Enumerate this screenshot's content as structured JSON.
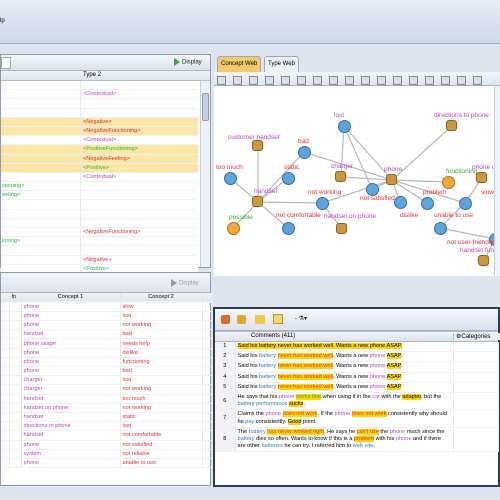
{
  "app": {
    "menu_help": "lp"
  },
  "left_top": {
    "display_label": "Display",
    "col_type2": "Type 2",
    "rows": [
      {
        "a": "",
        "b": "",
        "bg": "#ffffff"
      },
      {
        "a": "",
        "b": "<Contextual>",
        "bg": "#ffffff",
        "bcolor": "#c13fc1"
      },
      {
        "a": "",
        "b": "",
        "bg": "#ffffff"
      },
      {
        "a": "",
        "b": "",
        "bg": "#ffffff"
      },
      {
        "a": "",
        "b": "<Negative>",
        "bg": "#fbe6a6",
        "bcolor": "#e03030"
      },
      {
        "a": "",
        "b": "<NegativeFunctioning>",
        "bg": "#fbe6a6",
        "bcolor": "#e03030"
      },
      {
        "a": "",
        "b": "<Contextual>",
        "bg": "#ffffff",
        "bcolor": "#c13fc1"
      },
      {
        "a": "",
        "b": "<PositiveFunctioning>",
        "bg": "#fbe6a6",
        "bcolor": "#2db52d"
      },
      {
        "a": "",
        "b": "<NegativeFeeling>",
        "bg": "#fbe6a6",
        "bcolor": "#e03030"
      },
      {
        "a": "",
        "b": "<Positive>",
        "bg": "#fbe6a6",
        "bcolor": "#2db52d"
      },
      {
        "a": "",
        "b": "<Contextual>",
        "bg": "#ffffff",
        "bcolor": "#c13fc1"
      },
      {
        "a": "ctioning>",
        "b": "",
        "bg": "#ffffff",
        "acolor": "#2db52d"
      },
      {
        "a": "eeling>",
        "b": "",
        "bg": "#ffffff",
        "acolor": "#2db52d"
      },
      {
        "a": "",
        "b": "",
        "bg": "#ffffff"
      },
      {
        "a": "",
        "b": "",
        "bg": "#ffffff"
      },
      {
        "a": "",
        "b": "",
        "bg": "#ffffff"
      },
      {
        "a": "",
        "b": "<NegativeFunctioning>",
        "bg": "#ffffff",
        "bcolor": "#e03030"
      },
      {
        "a": "ioning>",
        "b": "",
        "bg": "#ffffff",
        "acolor": "#2db52d"
      },
      {
        "a": "",
        "b": "",
        "bg": "#ffffff"
      },
      {
        "a": "",
        "b": "<Negative>",
        "bg": "#ffffff",
        "bcolor": "#e03030"
      },
      {
        "a": "",
        "b": "<Positive>",
        "bg": "#ffffff",
        "bcolor": "#2db52d"
      }
    ]
  },
  "left_bottom": {
    "display_label": "Display",
    "col_in": "In",
    "col_c1": "Concept 1",
    "col_c2": "Concept 2",
    "rows": [
      {
        "c1": "phone",
        "c2": "slow"
      },
      {
        "c1": "phone",
        "c2": "lost"
      },
      {
        "c1": "phone",
        "c2": "not working"
      },
      {
        "c1": "handset",
        "c2": "bad"
      },
      {
        "c1": "phone usage",
        "c2": "needs help"
      },
      {
        "c1": "phone",
        "c2": "dislike"
      },
      {
        "c1": "phone",
        "c2": "functioning"
      },
      {
        "c1": "phone",
        "c2": "bad"
      },
      {
        "c1": "charger",
        "c2": "lost"
      },
      {
        "c1": "charger",
        "c2": "not working"
      },
      {
        "c1": "handset",
        "c2": "too much"
      },
      {
        "c1": "handset on phone",
        "c2": "not working"
      },
      {
        "c1": "handset",
        "c2": "static"
      },
      {
        "c1": "directions to phone",
        "c2": "lost"
      },
      {
        "c1": "handset",
        "c2": "not comfortable"
      },
      {
        "c1": "phone",
        "c2": "not satisfied"
      },
      {
        "c1": "system",
        "c2": "not reliable"
      },
      {
        "c1": "phone",
        "c2": "unable to use"
      }
    ]
  },
  "tabs": {
    "concept_web": "Concept Web",
    "type_web": "Type Web"
  },
  "graph": {
    "nodes": [
      {
        "id": "lost",
        "label": "lost",
        "color": "#c13fc1",
        "kind": "blue"
      },
      {
        "id": "directions",
        "label": "directions to phone",
        "color": "#c13fc1",
        "kind": "tan"
      },
      {
        "id": "customer_handset",
        "label": "customer handset",
        "color": "#c13fc1",
        "kind": "tan"
      },
      {
        "id": "bad",
        "label": "bad",
        "color": "#e03030",
        "kind": "blue"
      },
      {
        "id": "charger",
        "label": "charger",
        "color": "#c13fc1",
        "kind": "tan"
      },
      {
        "id": "phone",
        "label": "phone",
        "color": "#c13fc1",
        "kind": "tan"
      },
      {
        "id": "functioning",
        "label": "functioning",
        "color": "#2db52d",
        "kind": "orange"
      },
      {
        "id": "too_much",
        "label": "too much",
        "color": "#e03030",
        "kind": "blue"
      },
      {
        "id": "static",
        "label": "static",
        "color": "#e03030",
        "kind": "blue"
      },
      {
        "id": "phone_us",
        "label": "phone us",
        "color": "#c13fc1",
        "kind": "tan"
      },
      {
        "id": "handset",
        "label": "handset",
        "color": "#c13fc1",
        "kind": "tan"
      },
      {
        "id": "not_working",
        "label": "not working",
        "color": "#e03030",
        "kind": "blue"
      },
      {
        "id": "not_satisfied",
        "label": "not satisfied",
        "color": "#e03030",
        "kind": "blue"
      },
      {
        "id": "problem",
        "label": "problem",
        "color": "#e03030",
        "kind": "blue"
      },
      {
        "id": "slow",
        "label": "slow",
        "color": "#e03030",
        "kind": "blue"
      },
      {
        "id": "possible",
        "label": "possible",
        "color": "#2db52d",
        "kind": "orange"
      },
      {
        "id": "not_comfortable",
        "label": "not comfortable",
        "color": "#e03030",
        "kind": "blue"
      },
      {
        "id": "handset_on_phone",
        "label": "handset on phone",
        "color": "#c13fc1",
        "kind": "tan"
      },
      {
        "id": "dislike",
        "label": "dislike",
        "color": "#e03030",
        "kind": "blue"
      },
      {
        "id": "unable_to_use",
        "label": "unable to use",
        "color": "#e03030",
        "kind": "blue"
      },
      {
        "id": "not_user_friendly",
        "label": "not user-friendly",
        "color": "#e03030",
        "kind": "blue"
      },
      {
        "id": "handset_funct",
        "label": "handset funct",
        "color": "#c13fc1",
        "kind": "tan"
      }
    ]
  },
  "comments": {
    "header": "Comments (411)",
    "categories": "Categories",
    "rows": [
      {
        "num": "1",
        "html": "<span class='hl'>Said his battery never has worked well. Wants a new phone ASAP.</span>"
      },
      {
        "num": "2",
        "html": "Said his <span class='blu'>battery</span> <span class='hl neg'>never has worked well</span>. Wants a new <span class='prod'>phone</span> <span class='hl'>ASAP</span>."
      },
      {
        "num": "3",
        "html": "Said his <span class='blu'>battery</span> <span class='hl neg'>never has worked well</span>. Wants a new <span class='prod'>phone</span> <span class='hl'>ASAP</span>."
      },
      {
        "num": "4",
        "html": "Said his <span class='blu'>battery</span> <span class='hl neg'>never has worked well</span>. Wants a new <span class='prod'>phone</span> <span class='hl'>ASAP</span>."
      },
      {
        "num": "5",
        "html": "Said his <span class='blu'>battery</span> <span class='hl neg'>never has worked well</span>. Wants a new <span class='prod'>phone</span> <span class='hl'>ASAP</span>."
      },
      {
        "num": "6",
        "html": "He says that his <span class='prod'>phone</span> <span class='hl pos'>works fine</span> when using it in the <span class='prod'>car</span> with the <span class='hl'>adapter</span>, but the <span class='blu'>battery performance</span> <span class='hl'>sucks</span>."
      },
      {
        "num": "7",
        "html": "Claims the <span class='prod'>phone</span> <span class='hl neg'>does not work</span>. If the <span class='prod'>phone</span> <span class='hl neg'>does not work</span> consistently why should he <span class='blu'>pay</span> consistently. <span class='hl'>Good</span> point."
      },
      {
        "num": "8",
        "html": "The <span class='blu'>battery</span> <span class='hl neg'>has never worked right</span>. He says he <span class='hl neg'>can't use</span> the <span class='prod'>phone</span> much since the <span class='blu'>battery</span> dies so often. Wants to know if this is a <span class='hl neg'>problem</span> with his <span class='prod'>phone</span> and if there are other <span class='blu'>batteries</span> he can try. I referred him to <span class='blu'>web site</span>."
      }
    ]
  }
}
